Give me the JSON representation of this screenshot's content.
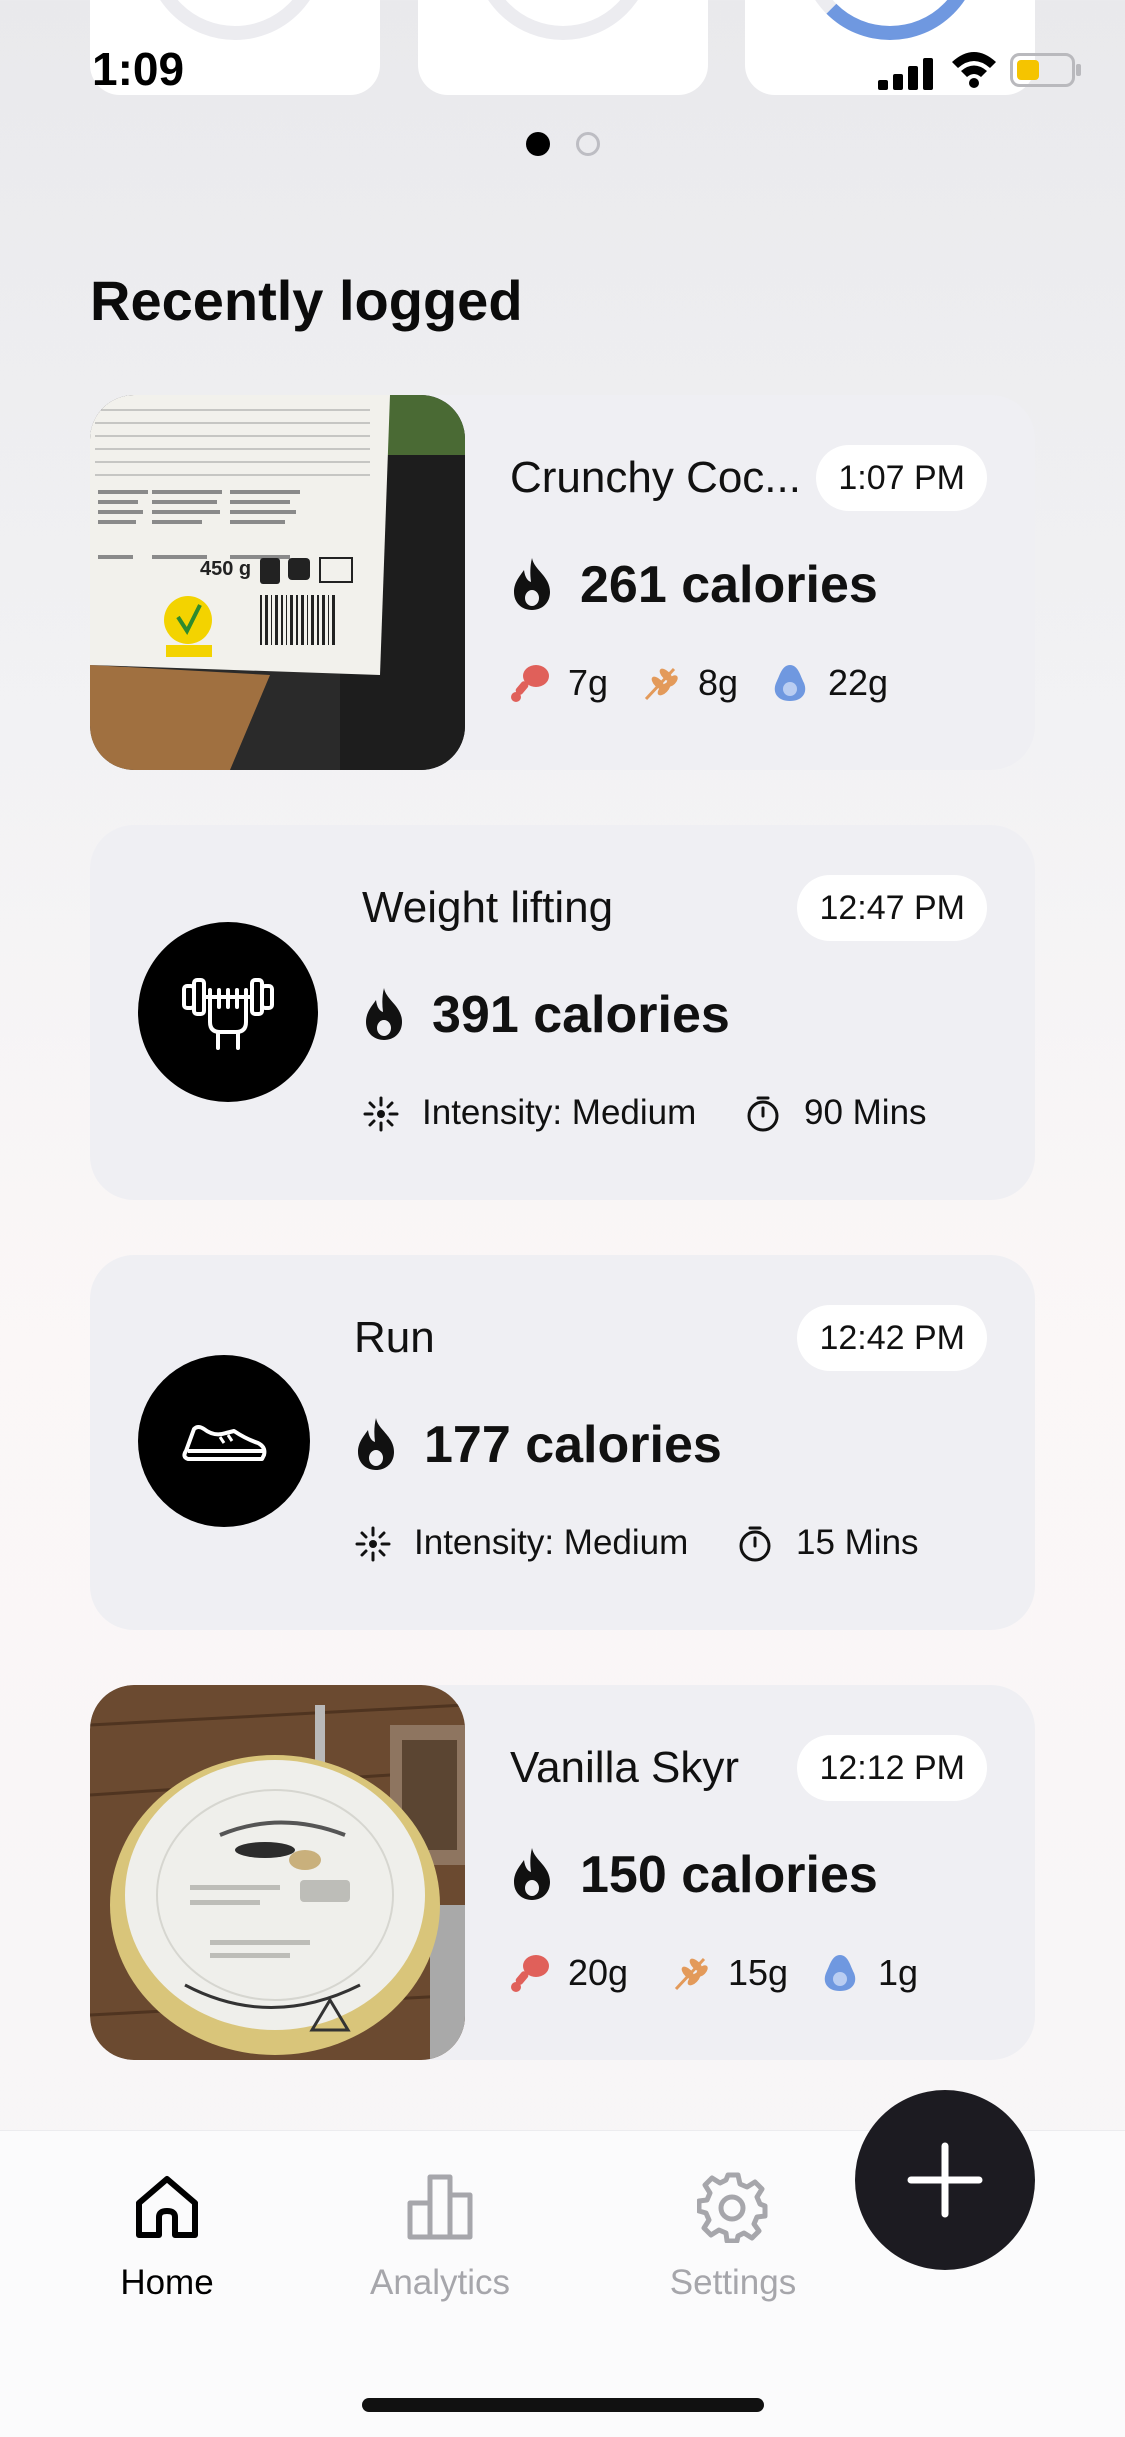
{
  "status_bar": {
    "time": "1:09"
  },
  "carousel": {
    "page_count": 2,
    "active_page": 1
  },
  "section": {
    "title": "Recently logged"
  },
  "entries": [
    {
      "type": "food",
      "name": "Crunchy Coc...",
      "time": "1:07 PM",
      "calories": "261 calories",
      "protein": "7g",
      "carbs": "8g",
      "fat": "22g",
      "photo": "nutrition-label-photo"
    },
    {
      "type": "exercise",
      "name": "Weight lifting",
      "time": "12:47 PM",
      "calories": "391 calories",
      "intensity": "Intensity: Medium",
      "duration": "90 Mins",
      "icon": "dumbbell-fist-icon"
    },
    {
      "type": "exercise",
      "name": "Run",
      "time": "12:42 PM",
      "calories": "177 calories",
      "intensity": "Intensity: Medium",
      "duration": "15 Mins",
      "icon": "running-shoe-icon"
    },
    {
      "type": "food",
      "name": "Vanilla Skyr",
      "time": "12:12 PM",
      "calories": "150 calories",
      "protein": "20g",
      "carbs": "15g",
      "fat": "1g",
      "photo": "yogurt-cup-photo"
    }
  ],
  "tabbar": {
    "tabs": [
      {
        "label": "Home",
        "icon": "home-icon",
        "active": true
      },
      {
        "label": "Analytics",
        "icon": "bar-chart-icon",
        "active": false
      },
      {
        "label": "Settings",
        "icon": "gear-icon",
        "active": false
      }
    ],
    "fab_icon": "plus-icon"
  },
  "colors": {
    "protein": "#e0605a",
    "carbs": "#e39a5a",
    "fat": "#6f98e0",
    "accent_ring": "#6f98e0",
    "fab": "#1c1b21"
  }
}
